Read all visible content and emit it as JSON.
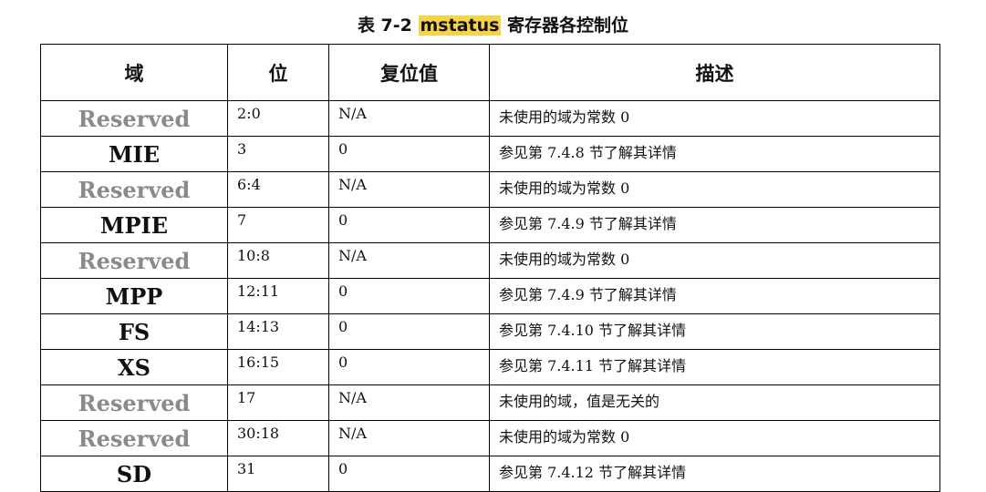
{
  "caption": {
    "prefix": "表 7-2 ",
    "highlight": "mstatus",
    "suffix": " 寄存器各控制位"
  },
  "table": {
    "headers": [
      "域",
      "位",
      "复位值",
      "描述"
    ],
    "rows": [
      {
        "field": "Reserved",
        "bits": "2:0",
        "reset": "N/A",
        "desc": "未使用的域为常数 0"
      },
      {
        "field": "MIE",
        "bits": "3",
        "reset": "0",
        "desc": "参见第 7.4.8 节了解其详情"
      },
      {
        "field": "Reserved",
        "bits": "6:4",
        "reset": "N/A",
        "desc": "未使用的域为常数 0"
      },
      {
        "field": "MPIE",
        "bits": "7",
        "reset": "0",
        "desc": "参见第 7.4.9 节了解其详情"
      },
      {
        "field": "Reserved",
        "bits": "10:8",
        "reset": "N/A",
        "desc": "未使用的域为常数 0"
      },
      {
        "field": "MPP",
        "bits": "12:11",
        "reset": "0",
        "desc": "参见第 7.4.9 节了解其详情"
      },
      {
        "field": "FS",
        "bits": "14:13",
        "reset": "0",
        "desc": "参见第 7.4.10 节了解其详情"
      },
      {
        "field": "XS",
        "bits": "16:15",
        "reset": "0",
        "desc": "参见第 7.4.11 节了解其详情"
      },
      {
        "field": "Reserved",
        "bits": "17",
        "reset": "N/A",
        "desc": "未使用的域，值是无关的"
      },
      {
        "field": "Reserved",
        "bits": "30:18",
        "reset": "N/A",
        "desc": "未使用的域为常数 0"
      },
      {
        "field": "SD",
        "bits": "31",
        "reset": "0",
        "desc": "参见第 7.4.12 节了解其详情"
      }
    ]
  }
}
